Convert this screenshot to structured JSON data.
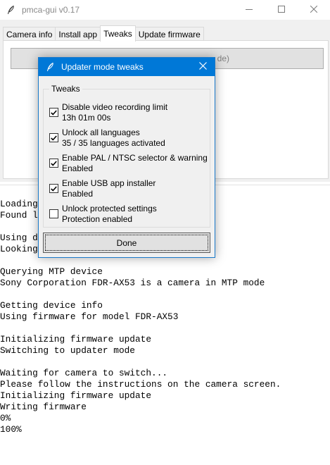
{
  "window": {
    "title": "pmca-gui v0.17",
    "icon": "feather-icon",
    "controls": [
      "minimize-icon",
      "maximize-icon",
      "close-icon"
    ]
  },
  "tabs": [
    {
      "label": "Camera info",
      "active": false
    },
    {
      "label": "Install app",
      "active": false
    },
    {
      "label": "Tweaks",
      "active": true
    },
    {
      "label": "Update firmware",
      "active": false
    }
  ],
  "tab_panel": {
    "partial_button_text": "de)"
  },
  "console": {
    "lines": [
      "Loading",
      "Found l",
      "",
      "Using d",
      "Looking",
      "",
      "Querying MTP device",
      "Sony Corporation FDR-AX53 is a camera in MTP mode",
      "",
      "Getting device info",
      "Using firmware for model FDR-AX53",
      "",
      "Initializing firmware update",
      "Switching to updater mode",
      "",
      "Waiting for camera to switch...",
      "Please follow the instructions on the camera screen.",
      "Initializing firmware update",
      "Writing firmware",
      "0%",
      "100%"
    ]
  },
  "dialog": {
    "title": "Updater mode tweaks",
    "icon": "feather-icon",
    "group_label": "Tweaks",
    "options": [
      {
        "label": "Disable video recording limit",
        "status": "13h 01m 00s",
        "checked": true
      },
      {
        "label": "Unlock all languages",
        "status": "35 / 35 languages activated",
        "checked": true
      },
      {
        "label": "Enable PAL / NTSC selector & warning",
        "status": "Enabled",
        "checked": true
      },
      {
        "label": "Enable USB app installer",
        "status": "Enabled",
        "checked": true
      },
      {
        "label": "Unlock protected settings",
        "status": "Protection enabled",
        "checked": false
      }
    ],
    "done_label": "Done"
  },
  "colors": {
    "dialog_titlebar": "#0078d7",
    "window_bg": "#f0f0f0",
    "button_bg": "#e1e1e1"
  }
}
